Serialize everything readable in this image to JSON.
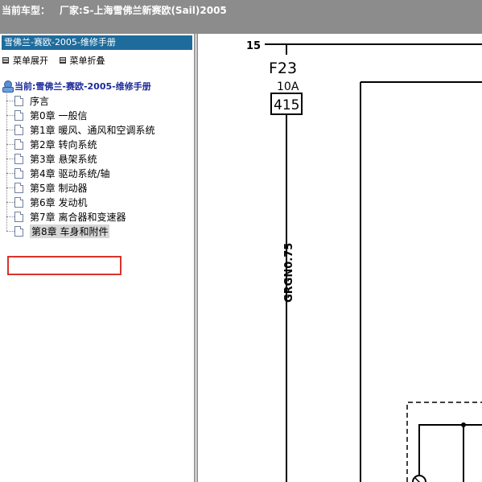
{
  "header": {
    "label": "当前车型：",
    "car": "厂家:S-上海雪佛兰新赛欧(Sail)2005"
  },
  "sidebar": {
    "title": "雪佛兰-赛欧-2005-维修手册",
    "expand_label": "菜单展开",
    "collapse_label": "菜单折叠",
    "root_label": "当前:雪佛兰-赛欧-2005-维修手册",
    "items": [
      {
        "label": "序言"
      },
      {
        "label": "第0章 一般信"
      },
      {
        "label": "第1章 暖风、通风和空调系统"
      },
      {
        "label": "第2章 转向系统"
      },
      {
        "label": "第3章 悬架系统"
      },
      {
        "label": "第4章 驱动系统/轴"
      },
      {
        "label": "第5章 制动器"
      },
      {
        "label": "第6章 发动机"
      },
      {
        "label": "第7章 离合器和变速器"
      },
      {
        "label": "第8章 车身和附件"
      }
    ],
    "selected_index": 9
  },
  "diagram": {
    "circuit_number": "15",
    "fuse_name": "F23",
    "fuse_rating": "10A",
    "fuse_code": "415",
    "wire_label": "GRGN0.75"
  },
  "colors": {
    "header_bg": "#8c8c8c",
    "sidebar_title_bg": "#1e6c9c",
    "root_label": "#1c2a9a",
    "highlight": "#d9332b"
  }
}
